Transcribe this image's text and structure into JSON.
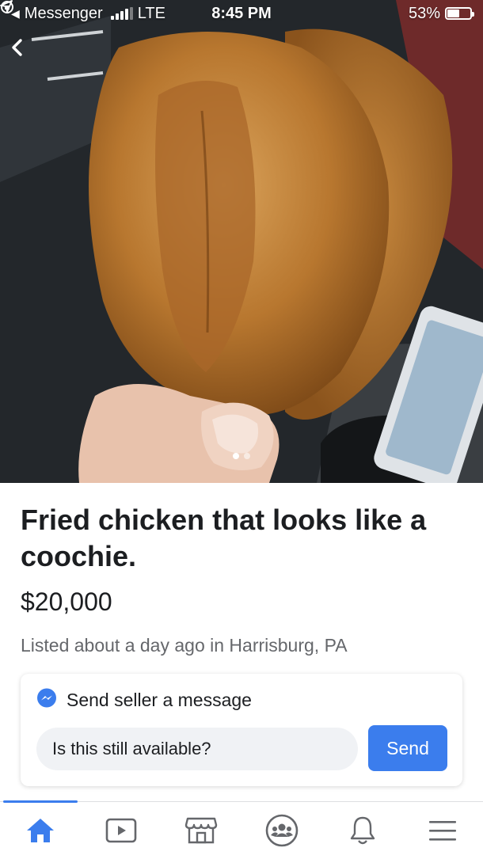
{
  "status_bar": {
    "back_app": "Messenger",
    "carrier": "LTE",
    "time": "8:45 PM",
    "battery": "53%",
    "battery_level": 0.53
  },
  "photo": {
    "current_index": 0,
    "count": 2
  },
  "listing": {
    "title": "Fried chicken that looks like a coochie.",
    "price": "$20,000",
    "meta": "Listed about a day ago in Harrisburg, PA"
  },
  "message": {
    "header": "Send seller a message",
    "input_value": "Is this still available?",
    "send_label": "Send"
  },
  "tabs": [
    {
      "name": "home",
      "icon": "home-icon",
      "active": true
    },
    {
      "name": "watch",
      "icon": "video-icon",
      "active": false
    },
    {
      "name": "marketplace",
      "icon": "marketplace-icon",
      "active": false
    },
    {
      "name": "groups",
      "icon": "groups-icon",
      "active": false
    },
    {
      "name": "notifications",
      "icon": "bell-icon",
      "active": false
    },
    {
      "name": "menu",
      "icon": "menu-icon",
      "active": false
    }
  ],
  "colors": {
    "accent": "#3b7ded",
    "text_primary": "#1c1e21",
    "text_secondary": "#65676b",
    "input_bg": "#f0f2f5",
    "icon_gray": "#65676b"
  }
}
